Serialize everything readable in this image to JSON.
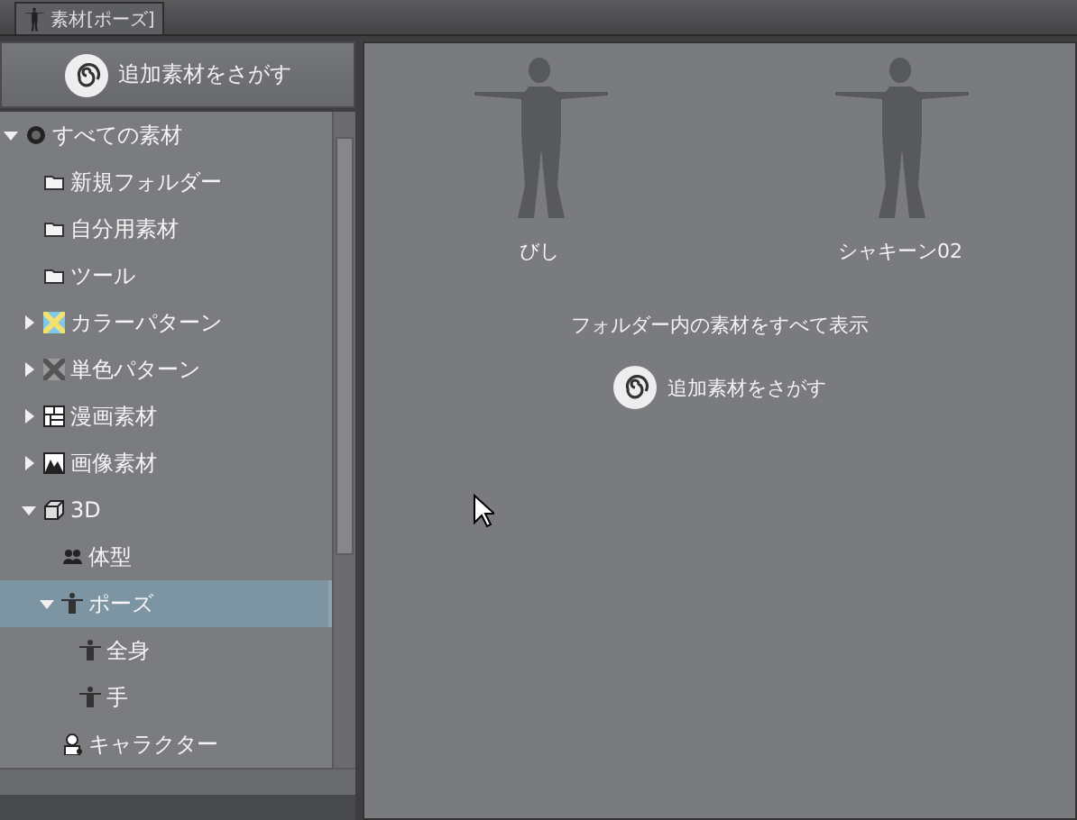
{
  "tab": {
    "label": "素材[ポーズ]",
    "selected": true
  },
  "search_button": {
    "label": "追加素材をさがす"
  },
  "tree": [
    {
      "label": "すべての素材",
      "kind": "all",
      "expanded": true,
      "selected": false,
      "children": [
        {
          "label": "新規フォルダー",
          "kind": "folder",
          "selected": false
        },
        {
          "label": "自分用素材",
          "kind": "folder",
          "selected": false
        },
        {
          "label": "ツール",
          "kind": "folder",
          "selected": false
        },
        {
          "label": "カラーパターン",
          "kind": "color-pattern",
          "expanded": false,
          "selected": false
        },
        {
          "label": "単色パターン",
          "kind": "mono-pattern",
          "expanded": false,
          "selected": false
        },
        {
          "label": "漫画素材",
          "kind": "manga",
          "expanded": false,
          "selected": false
        },
        {
          "label": "画像素材",
          "kind": "image",
          "expanded": false,
          "selected": false
        },
        {
          "label": "3D",
          "kind": "cube",
          "expanded": true,
          "selected": false,
          "children": [
            {
              "label": "体型",
              "kind": "body",
              "selected": false
            },
            {
              "label": "ポーズ",
              "kind": "pose",
              "expanded": true,
              "selected": true,
              "children": [
                {
                  "label": "全身",
                  "kind": "pose",
                  "selected": false
                },
                {
                  "label": "手",
                  "kind": "pose",
                  "selected": false
                }
              ]
            },
            {
              "label": "キャラクター",
              "kind": "character",
              "selected": false
            }
          ]
        }
      ]
    }
  ],
  "materials": [
    {
      "name": "びし"
    },
    {
      "name": "シャキーン02"
    }
  ],
  "show_all_link": "フォルダー内の素材をすべて表示",
  "search_button_2": {
    "label": "追加素材をさがす"
  }
}
